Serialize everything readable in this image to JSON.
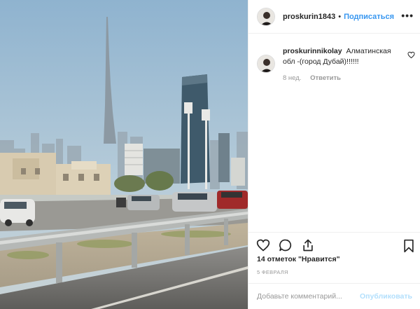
{
  "post": {
    "username": "proskurin1843",
    "separator": "•",
    "follow_label": "Подписаться",
    "more_label": "•••"
  },
  "comment": {
    "username": "proskurinnikolay",
    "text": "Алматинская обл -(город Дубай)!!!!!!",
    "time": "8 нед.",
    "reply_label": "Ответить"
  },
  "likes": {
    "text": "14 отметок \"Нравится\""
  },
  "date": "5 ФЕВРАЛЯ",
  "add_comment": {
    "placeholder": "Добавьте комментарий...",
    "publish_label": "Опубликовать"
  },
  "icons": {
    "like": "heart-icon",
    "comment": "comment-icon",
    "share": "share-icon",
    "save": "bookmark-icon",
    "comment_like": "heart-small-icon",
    "more": "more-icon"
  },
  "colors": {
    "link": "#3897f0",
    "publish_disabled": "#b2dffc",
    "muted": "#999999",
    "text": "#262626"
  }
}
